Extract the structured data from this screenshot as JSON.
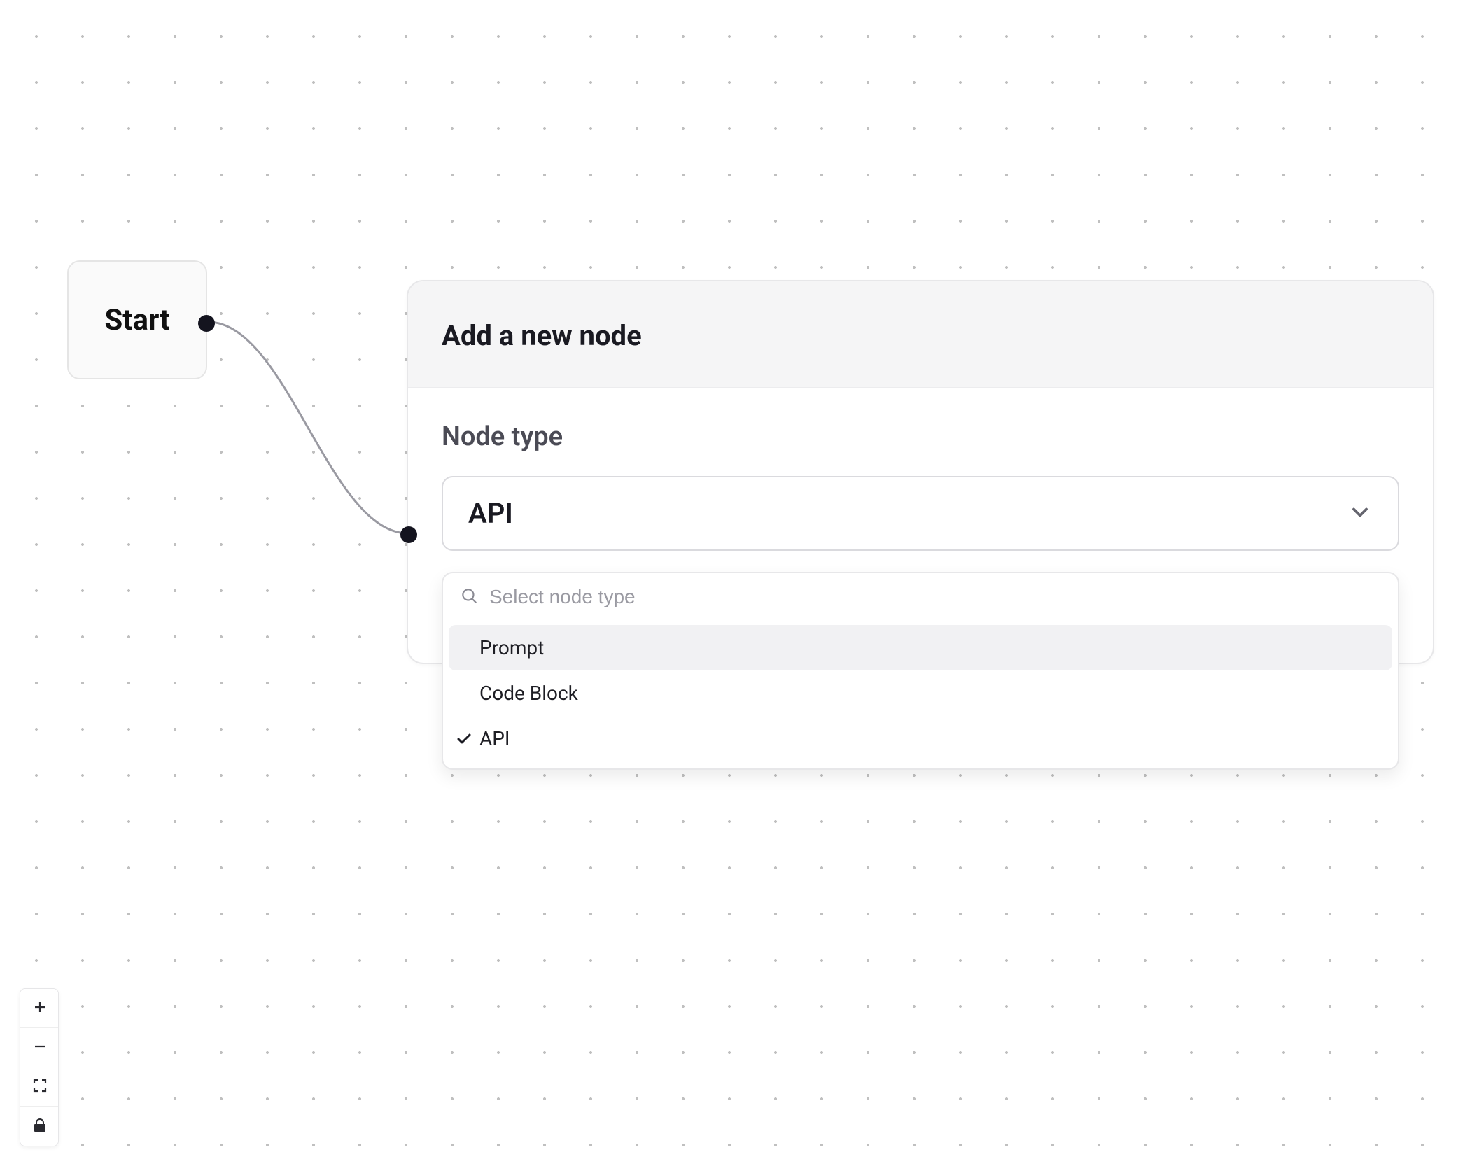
{
  "canvas": {
    "start_node_label": "Start"
  },
  "panel": {
    "title": "Add a new node",
    "section_label": "Node type",
    "selected_value": "API",
    "search_placeholder": "Select node type",
    "options": [
      {
        "label": "Prompt",
        "selected": false,
        "highlighted": true
      },
      {
        "label": "Code Block",
        "selected": false,
        "highlighted": false
      },
      {
        "label": "API",
        "selected": true,
        "highlighted": false
      }
    ]
  },
  "controls": {
    "zoom_in": "Zoom in",
    "zoom_out": "Zoom out",
    "fit": "Fit view",
    "lock": "Lock"
  },
  "colors": {
    "node_bg": "#fafafa",
    "border": "#e5e5e5",
    "port": "#14141f",
    "text": "#1a1a22",
    "muted": "#4b4b55"
  }
}
